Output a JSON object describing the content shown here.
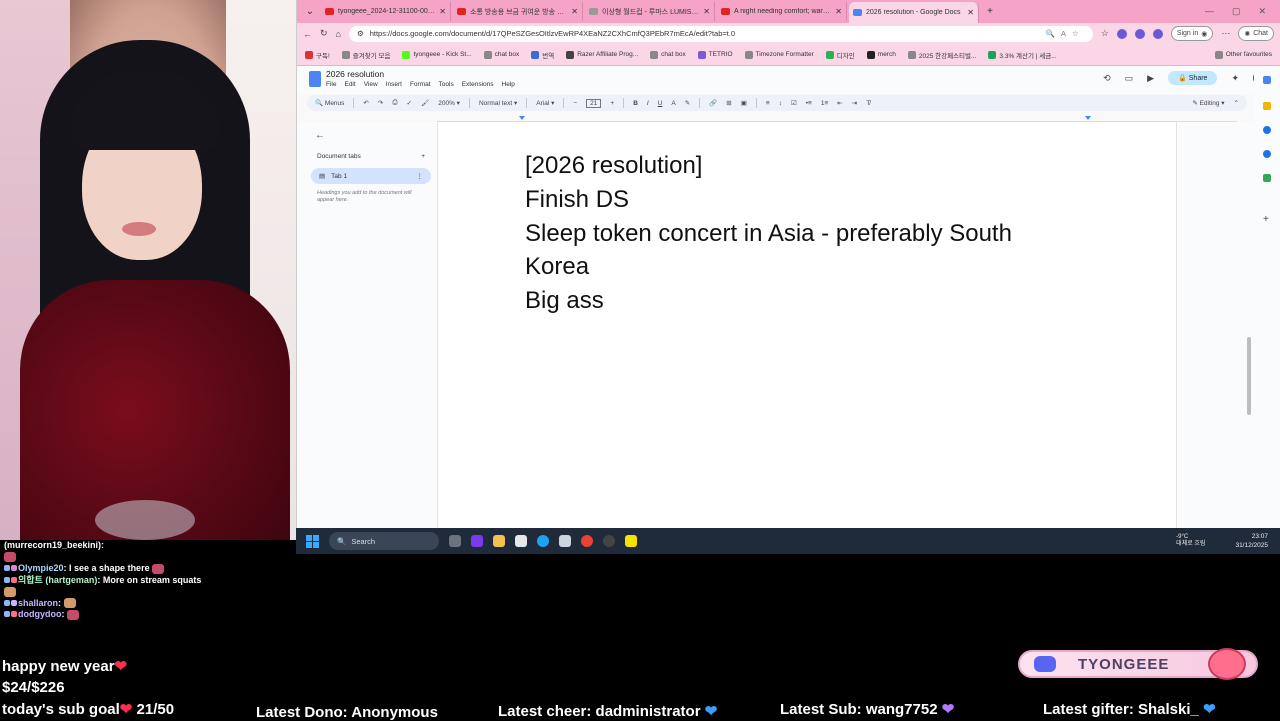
{
  "browser": {
    "tabs": [
      {
        "title": "tyongeee_2024-12-31100-00-002",
        "favicon": "youtube",
        "active": false
      },
      {
        "title": "소통 방송용 브금 귀여운 방송 브금",
        "favicon": "youtube",
        "active": false
      },
      {
        "title": "이상형 월드컵 - 루마스 LUMIS 202",
        "favicon": "web",
        "active": false
      },
      {
        "title": "A night needing comfort; warm jp",
        "favicon": "youtube",
        "active": false
      },
      {
        "title": "2026 resolution - Google Docs",
        "favicon": "docs",
        "active": true
      }
    ],
    "new_tab": "+",
    "url": "https://docs.google.com/document/d/17QPeSZGesOItlzvEwRP4XEaNZ2CXhCmfQ3PEbR7mEcA/edit?tab=t.0",
    "sign_in": "Sign in",
    "chat": "Chat",
    "bookmarks": [
      "구독!",
      "즐겨찾기 모음",
      "tyongeee - Kick St...",
      "chat box",
      "번역",
      "Razer Affiliate Prog...",
      "chat box",
      "TETRIO",
      "Timezone Formatter",
      "디자인",
      "merch",
      "2025 한강페스티벌...",
      "3.3% 계산기 | 세금..."
    ],
    "other_favourites": "Other favourites"
  },
  "docs": {
    "title": "2026 resolution",
    "menu": [
      "File",
      "Edit",
      "View",
      "Insert",
      "Format",
      "Tools",
      "Extensions",
      "Help"
    ],
    "share": "Share",
    "toolbar": {
      "menus": "Menus",
      "zoom": "200%",
      "style": "Normal text",
      "font": "Arial",
      "font_size": "21",
      "mode": "Editing"
    },
    "panel": {
      "heading": "Document tabs",
      "tab_name": "Tab 1",
      "hint": "Headings you add to the document will appear here."
    },
    "lines": [
      "[2026 resolution]",
      "Finish DS",
      "Sleep token concert in Asia - preferably South",
      "Korea",
      "Big ass"
    ]
  },
  "taskbar": {
    "search": "Search",
    "temp": "-9°C",
    "weather": "대체로 흐림",
    "time": "23:07",
    "date": "31/12/2025"
  },
  "chat": [
    {
      "user": "(murrecorn19_beekini)",
      "msg": ""
    },
    {
      "user": "Olympie20",
      "msg": "I see a shape there"
    },
    {
      "user": "의합트 (hartgeman)",
      "msg": "More on stream squats"
    },
    {
      "user": "shallaron",
      "msg": ""
    },
    {
      "user": "dodgydoo",
      "msg": ""
    }
  ],
  "overlay": {
    "greeting": "happy new year",
    "donation_progress": "$24/$226",
    "sub_goal": "today's sub goal",
    "sub_count": "21/50",
    "latest_dono": "Latest Dono: Anonymous",
    "latest_cheer": "Latest cheer: dadministrator",
    "latest_sub": "Latest Sub: wang7752",
    "latest_gifter": "Latest gifter: Shalski_",
    "channel": "TYONGEEE"
  }
}
